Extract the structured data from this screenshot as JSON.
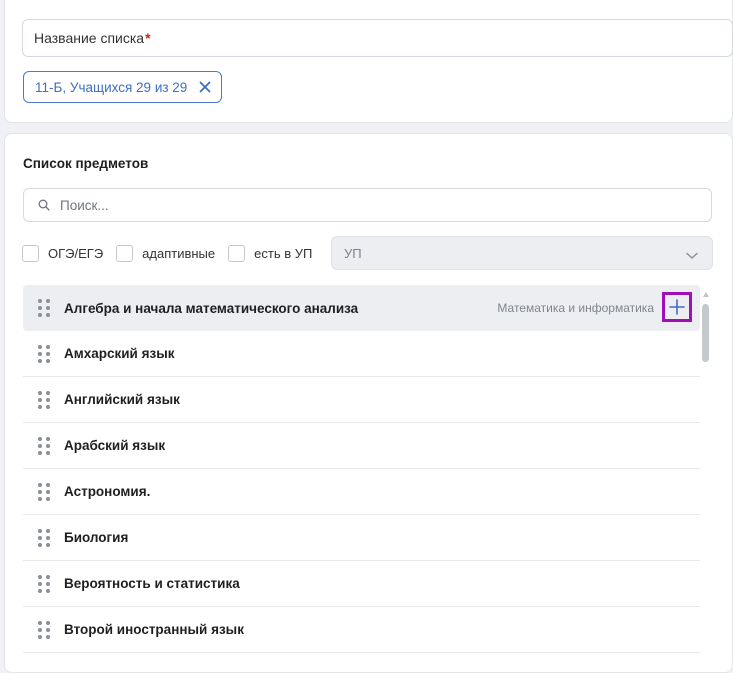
{
  "form": {
    "name_label": "Название списка",
    "required_mark": "*",
    "chip_label": "11-Б, Учащихся 29 из 29"
  },
  "subjects": {
    "title": "Список предметов",
    "search_placeholder": "Поиск...",
    "filters": [
      {
        "label": "ОГЭ/ЕГЭ",
        "checked": false
      },
      {
        "label": "адаптивные",
        "checked": false
      },
      {
        "label": "есть в УП",
        "checked": false
      }
    ],
    "plan_select": "УП",
    "items": [
      {
        "name": "Алгебра и начала математического анализа",
        "category": "Математика и информатика"
      },
      {
        "name": "Амхарский язык"
      },
      {
        "name": "Английский язык"
      },
      {
        "name": "Арабский язык"
      },
      {
        "name": "Астрономия."
      },
      {
        "name": "Биология"
      },
      {
        "name": "Вероятность и статистика"
      },
      {
        "name": "Второй иностранный язык"
      }
    ]
  },
  "colors": {
    "accent": "#3e6fc5",
    "highlight": "#a010b8",
    "required": "#d0231c"
  }
}
